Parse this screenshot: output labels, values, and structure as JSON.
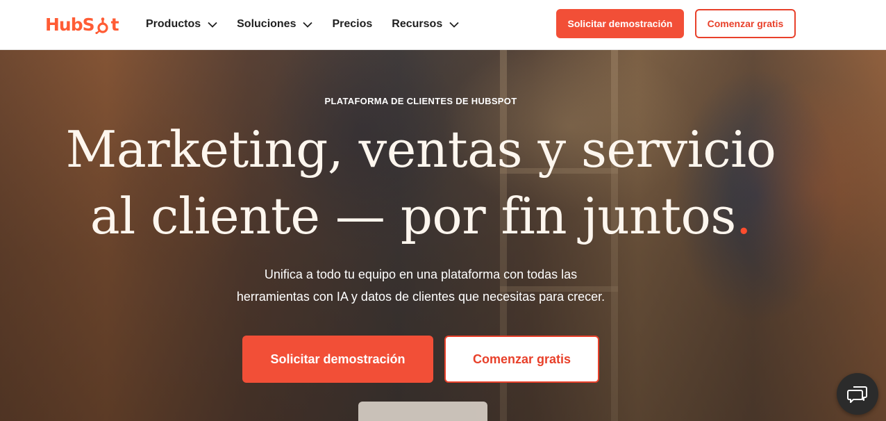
{
  "header": {
    "brand": "HubSpot",
    "nav": [
      {
        "label": "Productos",
        "has_dropdown": true
      },
      {
        "label": "Soluciones",
        "has_dropdown": true
      },
      {
        "label": "Precios",
        "has_dropdown": false
      },
      {
        "label": "Recursos",
        "has_dropdown": true
      }
    ],
    "demo_button": "Solicitar demostración",
    "free_button": "Comenzar gratis"
  },
  "hero": {
    "eyebrow": "PLATAFORMA DE CLIENTES DE HUBSPOT",
    "headline_line1": "Marketing, ventas y servicio",
    "headline_line2": "al cliente — por fin juntos",
    "headline_dot": ".",
    "subtitle_line1": "Unifica a todo tu equipo en una plataforma con todas las",
    "subtitle_line2": "herramientas con IA y datos de clientes que necesitas para crecer.",
    "cta_primary": "Solicitar demostración",
    "cta_secondary": "Comenzar gratis"
  },
  "icons": {
    "logo": "hubspot-sprocket-icon",
    "nav_dropdown": "chevron-down-icon",
    "chat": "chat-bubbles-icon"
  },
  "colors": {
    "accent": "#f24f37",
    "accent_text": "#e8402a",
    "logo": "#ff5c35",
    "headline": "#fdf6ee",
    "chat_bg": "#2b2b2b"
  }
}
